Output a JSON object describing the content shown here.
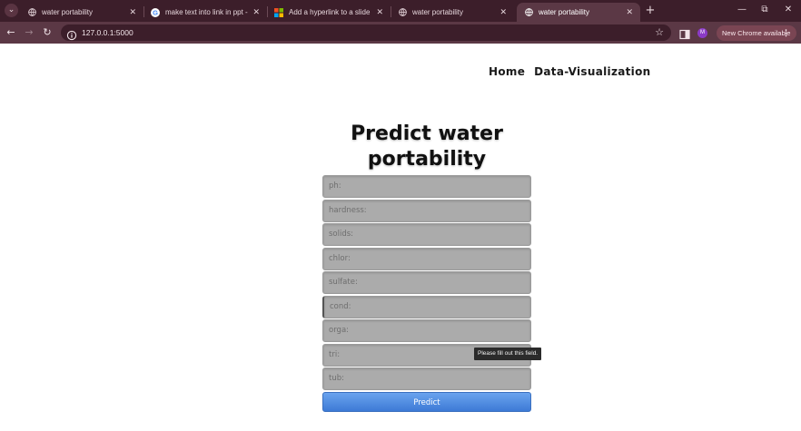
{
  "browser": {
    "tabs": [
      {
        "title": "water portability",
        "favicon": "globe-icon",
        "active": false
      },
      {
        "title": "make text into link in ppt - Goo",
        "favicon": "google-icon",
        "active": false
      },
      {
        "title": "Add a hyperlink to a slide - Mic",
        "favicon": "microsoft-icon",
        "active": false
      },
      {
        "title": "water portability",
        "favicon": "globe-icon",
        "active": false
      },
      {
        "title": "water portability",
        "favicon": "globe-icon",
        "active": true
      }
    ],
    "address": "127.0.0.1:5000",
    "profile_initial": "M",
    "update_label": "New Chrome available",
    "colors": {
      "frame": "#3c1e2a",
      "toolbar": "#5b3845"
    }
  },
  "page": {
    "nav": [
      {
        "label": "Home"
      },
      {
        "label": "Data-Visualization"
      }
    ],
    "heading_line1": "Predict water",
    "heading_line2": "portability",
    "fields": [
      {
        "placeholder": "ph:"
      },
      {
        "placeholder": "hardness:"
      },
      {
        "placeholder": "solids:"
      },
      {
        "placeholder": "chlor:"
      },
      {
        "placeholder": "sulfate:"
      },
      {
        "placeholder": "cond:"
      },
      {
        "placeholder": "orga:"
      },
      {
        "placeholder": "tri:"
      },
      {
        "placeholder": "tub:"
      }
    ],
    "submit_label": "Predict",
    "validation_message": "Please fill out this field.",
    "colors": {
      "button": "#4a86e0",
      "field": "#ababab"
    }
  }
}
